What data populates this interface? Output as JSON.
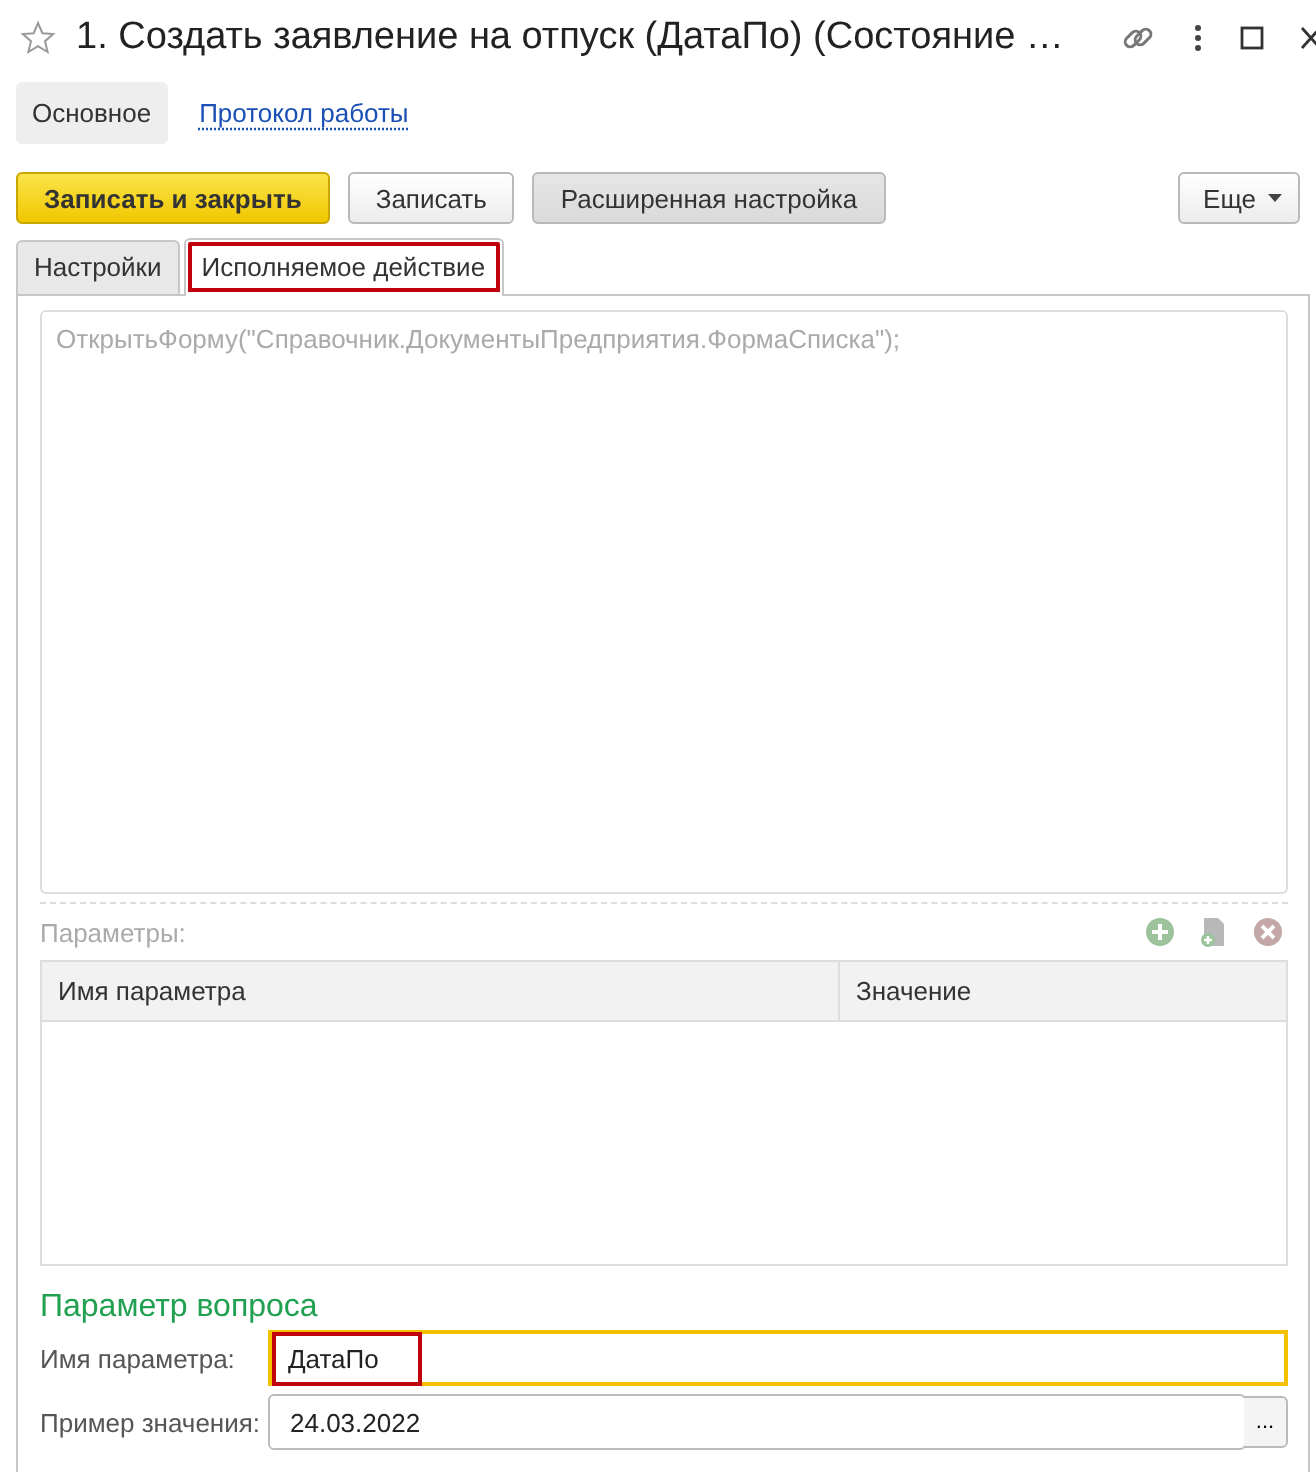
{
  "window": {
    "title": "1. Создать заявление на отпуск (ДатаПо) (Состояние …",
    "favorite": false
  },
  "nav": [
    {
      "label": "Основное",
      "selected": true
    },
    {
      "label": "Протокол работы",
      "selected": false
    }
  ],
  "toolbar": [
    {
      "label": "Записать и закрыть",
      "kind": "primary"
    },
    {
      "label": "Записать",
      "kind": "normal"
    },
    {
      "label": "Расширенная настройка",
      "kind": "pressed"
    },
    {
      "label": "Еще",
      "kind": "menu"
    }
  ],
  "tabs": [
    {
      "label": "Настройки",
      "selected": false,
      "highlighted": false
    },
    {
      "label": "Исполняемое действие",
      "selected": true,
      "highlighted": true
    }
  ],
  "code": {
    "text": "ОткрытьФорму(\"Справочник.ДокументыПредприятия.ФормаСписка\");",
    "disabled": true
  },
  "parameters": {
    "label": "Параметры:",
    "columns": [
      "Имя параметра",
      "Значение"
    ]
  },
  "question": {
    "title": "Параметр вопроса",
    "fields": [
      {
        "label": "Имя параметра:",
        "value": "ДатаПо",
        "focused": true,
        "highlighted": true,
        "kind": "text"
      },
      {
        "label": "Пример значения:",
        "value": "24.03.2022",
        "focused": false,
        "highlighted": false,
        "kind": "choice",
        "button": "..."
      }
    ]
  }
}
